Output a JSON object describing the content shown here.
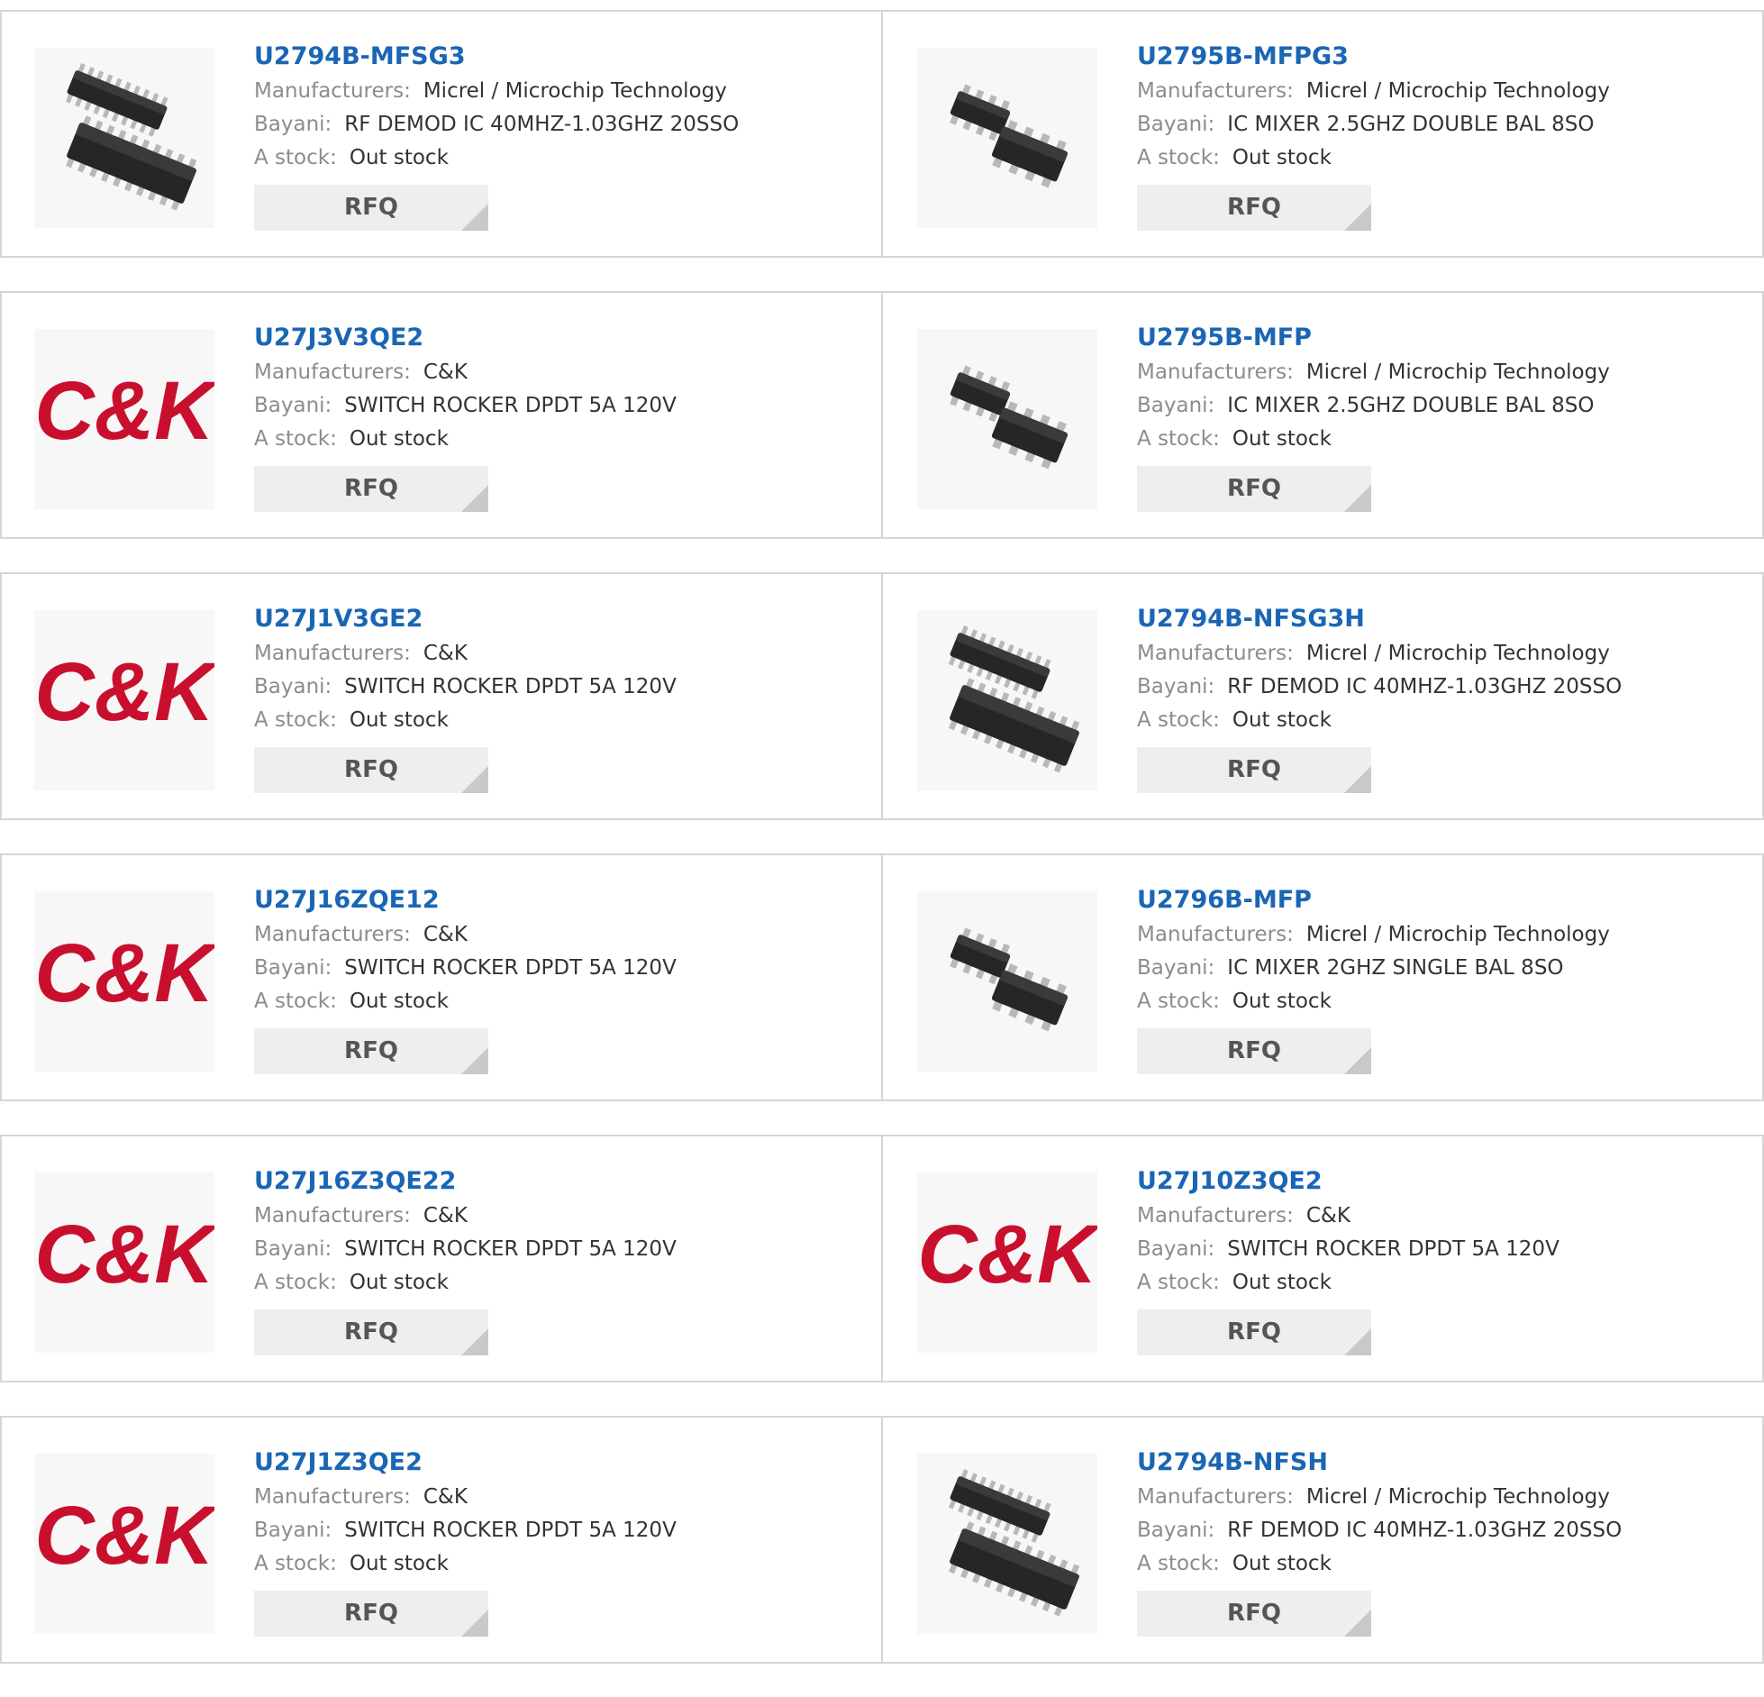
{
  "labels": {
    "manufacturer": "Manufacturers:",
    "description": "Bayani:",
    "stock": "A stock:",
    "rfq": "RFQ"
  },
  "products": [
    {
      "part": "U2794B-MFSG3",
      "manufacturer": "Micrel / Microchip Technology",
      "description": "RF DEMOD IC 40MHZ-1.03GHZ 20SSO",
      "stock": "Out stock",
      "image": "soic-20-chip-icon"
    },
    {
      "part": "U2795B-MFPG3",
      "manufacturer": "Micrel / Microchip Technology",
      "description": "IC MIXER 2.5GHZ DOUBLE BAL 8SO",
      "stock": "Out stock",
      "image": "soic-8-chip-icon"
    },
    {
      "part": "U27J3V3QE2",
      "manufacturer": "C&K",
      "description": "SWITCH ROCKER DPDT 5A 120V",
      "stock": "Out stock",
      "image": "ck-logo"
    },
    {
      "part": "U2795B-MFP",
      "manufacturer": "Micrel / Microchip Technology",
      "description": "IC MIXER 2.5GHZ DOUBLE BAL 8SO",
      "stock": "Out stock",
      "image": "soic-8-chip-icon"
    },
    {
      "part": "U27J1V3GE2",
      "manufacturer": "C&K",
      "description": "SWITCH ROCKER DPDT 5A 120V",
      "stock": "Out stock",
      "image": "ck-logo"
    },
    {
      "part": "U2794B-NFSG3H",
      "manufacturer": "Micrel / Microchip Technology",
      "description": "RF DEMOD IC 40MHZ-1.03GHZ 20SSO",
      "stock": "Out stock",
      "image": "soic-20-chip-icon"
    },
    {
      "part": "U27J16ZQE12",
      "manufacturer": "C&K",
      "description": "SWITCH ROCKER DPDT 5A 120V",
      "stock": "Out stock",
      "image": "ck-logo"
    },
    {
      "part": "U2796B-MFP",
      "manufacturer": "Micrel / Microchip Technology",
      "description": "IC MIXER 2GHZ SINGLE BAL 8SO",
      "stock": "Out stock",
      "image": "soic-8-chip-icon"
    },
    {
      "part": "U27J16Z3QE22",
      "manufacturer": "C&K",
      "description": "SWITCH ROCKER DPDT 5A 120V",
      "stock": "Out stock",
      "image": "ck-logo"
    },
    {
      "part": "U27J10Z3QE2",
      "manufacturer": "C&K",
      "description": "SWITCH ROCKER DPDT 5A 120V",
      "stock": "Out stock",
      "image": "ck-logo"
    },
    {
      "part": "U27J1Z3QE2",
      "manufacturer": "C&K",
      "description": "SWITCH ROCKER DPDT 5A 120V",
      "stock": "Out stock",
      "image": "ck-logo"
    },
    {
      "part": "U2794B-NFSH",
      "manufacturer": "Micrel / Microchip Technology",
      "description": "RF DEMOD IC 40MHZ-1.03GHZ 20SSO",
      "stock": "Out stock",
      "image": "soic-20-chip-icon"
    }
  ],
  "colors": {
    "part_link": "#1a66b5",
    "label_gray": "#8c8c8c",
    "ck_logo_red": "#c8102e",
    "border": "#d6d6d6"
  }
}
